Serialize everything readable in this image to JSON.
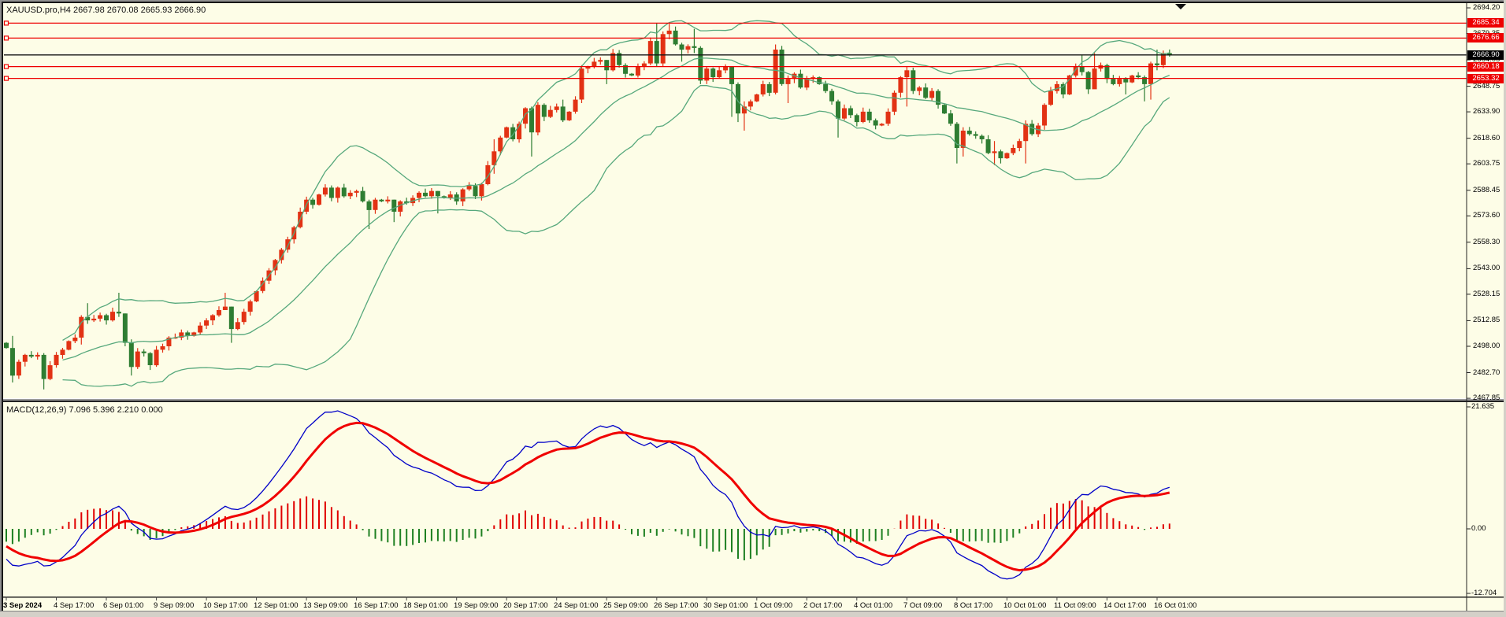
{
  "window": {
    "symbol_header": "XAUUSD.pro,H4  2667.98 2670.08 2665.93 2666.90",
    "macd_header": "MACD(12,26,9) 7.096 5.396 2.210 0.000"
  },
  "colors": {
    "background": "#fdfde7",
    "bull_candle": "#e23214",
    "bear_candle": "#2e7d32",
    "bollinger": "#56a87c",
    "level_line": "#ee0000",
    "bid_line": "#151515",
    "level_box": "#ee0000",
    "bid_box": "#000000",
    "macd_main": "#0000c8",
    "macd_signal": "#f00000",
    "hist_up": "#e00000",
    "hist_down": "#1e8022"
  },
  "chart_data": {
    "type": "candlestick",
    "symbol": "XAUUSD.pro",
    "timeframe": "H4",
    "ohlc_display": {
      "open": "2667.98",
      "high": "2670.08",
      "low": "2665.93",
      "close": "2666.90"
    },
    "price_axis_ticks": [
      2694.2,
      2679.35,
      2664.05,
      2648.75,
      2633.9,
      2618.6,
      2603.75,
      2588.45,
      2573.6,
      2558.3,
      2543.0,
      2528.15,
      2512.85,
      2498.0,
      2482.7,
      2467.85
    ],
    "date_labels": [
      "3 Sep 2024",
      "4 Sep 17:00",
      "6 Sep 01:00",
      "9 Sep 09:00",
      "10 Sep 17:00",
      "12 Sep 01:00",
      "13 Sep 09:00",
      "16 Sep 17:00",
      "18 Sep 01:00",
      "19 Sep 09:00",
      "20 Sep 17:00",
      "24 Sep 01:00",
      "25 Sep 09:00",
      "26 Sep 17:00",
      "30 Sep 01:00",
      "1 Oct 09:00",
      "2 Oct 17:00",
      "4 Oct 01:00",
      "7 Oct 09:00",
      "8 Oct 17:00",
      "10 Oct 01:00",
      "11 Oct 09:00",
      "14 Oct 17:00",
      "16 Oct 01:00"
    ],
    "price_levels": [
      {
        "price": 2685.34,
        "label": "2685.34",
        "style": "level"
      },
      {
        "price": 2676.66,
        "label": "2676.66",
        "style": "level"
      },
      {
        "price": 2666.9,
        "label": "2666.90",
        "style": "bid"
      },
      {
        "price": 2660.18,
        "label": "2660.18",
        "style": "level"
      },
      {
        "price": 2653.32,
        "label": "2653.32",
        "style": "level"
      }
    ],
    "candles": {
      "first_open": 2500,
      "closes": [
        2497,
        2481,
        2489,
        2493,
        2492,
        2493,
        2479,
        2487,
        2493,
        2496,
        2501,
        2503,
        2515,
        2513,
        2514,
        2516,
        2513,
        2518,
        2517,
        2500,
        2486,
        2495,
        2494,
        2487,
        2496,
        2498,
        2503,
        2503,
        2506,
        2504,
        2506,
        2510,
        2513,
        2516,
        2519,
        2521,
        2508,
        2512,
        2518,
        2524,
        2530,
        2536,
        2542,
        2548,
        2554,
        2560,
        2567,
        2576,
        2583,
        2580,
        2586,
        2590,
        2584,
        2590,
        2585,
        2587,
        2588,
        2582,
        2577,
        2583,
        2582,
        2583,
        2576,
        2582,
        2581,
        2584,
        2587,
        2585,
        2588,
        2585,
        2584,
        2586,
        2582,
        2589,
        2591,
        2585,
        2592,
        2603,
        2611,
        2619,
        2625,
        2618,
        2627,
        2636,
        2622,
        2638,
        2631,
        2635,
        2637,
        2629,
        2634,
        2641,
        2659,
        2660,
        2663,
        2664,
        2658,
        2668,
        2661,
        2656,
        2655,
        2660,
        2662,
        2675,
        2662,
        2679,
        2681,
        2673,
        2670,
        2672,
        2671,
        2652,
        2659,
        2654,
        2658,
        2660,
        2650,
        2633,
        2637,
        2640,
        2644,
        2650,
        2645,
        2670,
        2650,
        2653,
        2656,
        2648,
        2653,
        2654,
        2650,
        2646,
        2640,
        2630,
        2636,
        2632,
        2628,
        2634,
        2629,
        2626,
        2627,
        2634,
        2645,
        2654,
        2658,
        2646,
        2648,
        2642,
        2646,
        2638,
        2633,
        2627,
        2613,
        2623,
        2621,
        2620,
        2618,
        2610,
        2611,
        2607,
        2610,
        2613,
        2617,
        2627,
        2621,
        2626,
        2638,
        2646,
        2650,
        2644,
        2655,
        2660,
        2657,
        2647,
        2659,
        2661,
        2653,
        2650,
        2653,
        2651,
        2655,
        2654,
        2650,
        2662,
        2661,
        2667.98,
        2666.9
      ],
      "wick_overrides": {
        "1": [
          2504,
          2477
        ],
        "6": [
          2494,
          2473
        ],
        "12": [
          2516,
          2499
        ],
        "13": [
          2523,
          2511
        ],
        "18": [
          2529,
          2515
        ],
        "19": [
          2517,
          2498
        ],
        "20": [
          2502,
          2481
        ],
        "35": [
          2529,
          2519
        ],
        "36": [
          2521,
          2500
        ],
        "44": [
          2555,
          2546
        ],
        "58": [
          2583,
          2566
        ],
        "62": [
          2583,
          2570
        ],
        "69": [
          2588,
          2575
        ],
        "78": [
          2618,
          2598
        ],
        "84": [
          2637,
          2608
        ],
        "89": [
          2641,
          2628
        ],
        "92": [
          2661,
          2639
        ],
        "96": [
          2664,
          2650
        ],
        "103": [
          2677,
          2661
        ],
        "104": [
          2685.5,
          2660
        ],
        "106": [
          2685,
          2676
        ],
        "108": [
          2674,
          2663
        ],
        "110": [
          2682,
          2668
        ],
        "111": [
          2672,
          2650
        ],
        "116": [
          2660,
          2631
        ],
        "117": [
          2651,
          2628
        ],
        "118": [
          2640,
          2623
        ],
        "123": [
          2673,
          2644
        ],
        "125": [
          2655,
          2639
        ],
        "133": [
          2641,
          2619
        ],
        "144": [
          2660,
          2637
        ],
        "152": [
          2628,
          2604
        ],
        "153": [
          2625,
          2608
        ],
        "158": [
          2617,
          2603
        ],
        "159": [
          2612,
          2604
        ],
        "163": [
          2629,
          2604
        ],
        "172": [
          2667,
          2655
        ],
        "174": [
          2668,
          2650
        ],
        "179": [
          2654,
          2644
        ],
        "182": [
          2655,
          2640
        ],
        "183": [
          2663,
          2641
        ],
        "184": [
          2670,
          2658
        ],
        "186": [
          2670.08,
          2665.93
        ]
      }
    },
    "indicators": {
      "bollinger": {
        "period": 20,
        "deviation": 2
      },
      "macd": {
        "fast": 12,
        "slow": 26,
        "signal": 9,
        "axis_labels": [
          "21.635",
          "0.00",
          "-12.704"
        ],
        "current_values": [
          "7.096",
          "5.396",
          "2.210",
          "0.000"
        ]
      }
    }
  }
}
